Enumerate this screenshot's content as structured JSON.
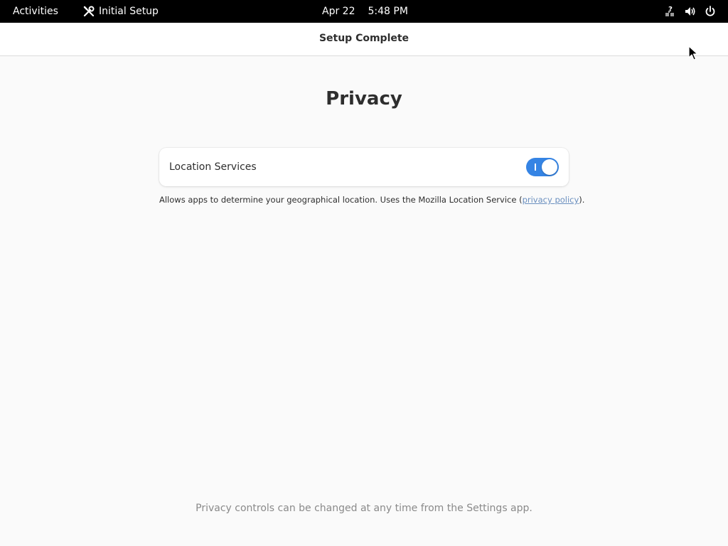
{
  "topbar": {
    "activities_label": "Activities",
    "app_name": "Initial Setup",
    "app_icon": "tools-icon",
    "date": "Apr 22",
    "time": "5:48 PM",
    "tray_icons": [
      "network-unknown-icon",
      "volume-icon",
      "power-icon"
    ]
  },
  "header": {
    "title": "Setup Complete"
  },
  "main": {
    "title": "Privacy",
    "location_services": {
      "label": "Location Services",
      "enabled": true
    },
    "description_prefix": "Allows apps to determine your geographical location. Uses the Mozilla Location Service (",
    "privacy_link": "privacy policy",
    "description_suffix": ").",
    "footer_note": "Privacy controls can be changed at any time from the Settings app."
  },
  "colors": {
    "toggle_on": "#3584e4",
    "link": "#6a8fbf",
    "background": "#fafafa",
    "topbar": "#000000"
  }
}
